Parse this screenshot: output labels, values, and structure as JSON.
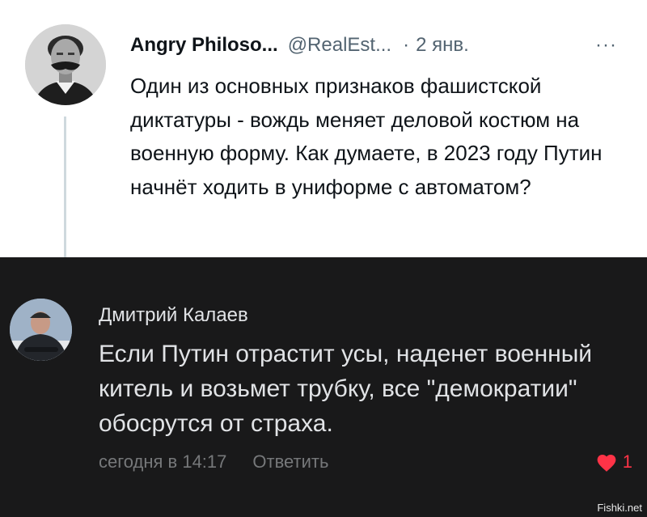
{
  "tweet": {
    "author_name": "Angry Philoso...",
    "author_handle": "@RealEst...",
    "separator": "·",
    "date": "2 янв.",
    "more_label": "···",
    "text": "Один из основных признаков фашистской диктатуры - вождь меняет деловой костюм на военную форму. Как думаете, в 2023 году Путин начнёт ходить в униформе с автоматом?",
    "avatar_icon": "portrait-avatar-icon"
  },
  "comment": {
    "author_name": "Дмитрий Калаев",
    "text": "Если Путин отрастит усы, наденет военный китель и возьмет трубку, все \"демократии\" обосрутся от страха.",
    "timestamp": "сегодня в 14:17",
    "reply_label": "Ответить",
    "like_count": "1",
    "like_color": "#ff3347",
    "avatar_icon": "user-photo-avatar-icon"
  },
  "watermark": "Fishki.net"
}
